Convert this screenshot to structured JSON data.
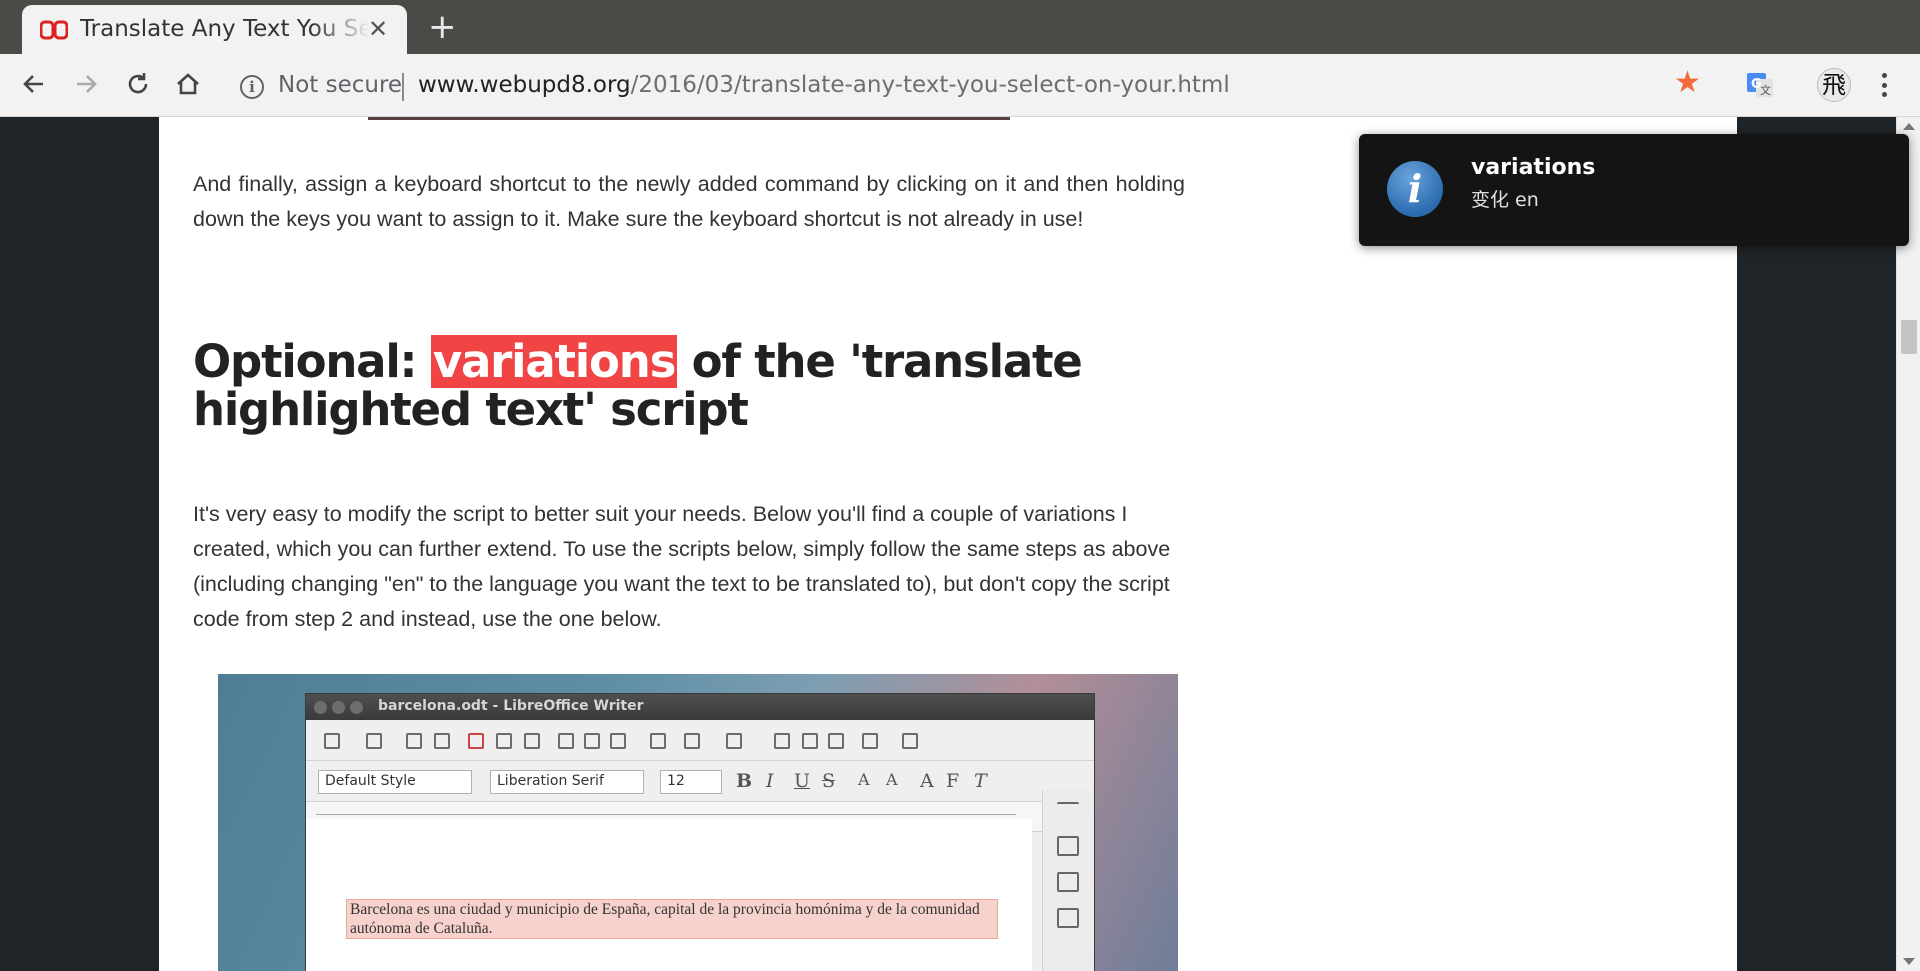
{
  "browser": {
    "tab_title": "Translate Any Text You Select on Your Desktop",
    "url_security": "Not secure",
    "url_host": "www.webupd8.org",
    "url_path": "/2016/03/translate-any-text-you-select-on-your.html",
    "avatar_glyph": "飛"
  },
  "article": {
    "para1": "And finally, assign a keyboard shortcut to the newly added command by clicking on it and then holding down the keys you want to assign to it. Make sure the keyboard shortcut is not already in use!",
    "heading_prefix": "Optional: ",
    "heading_highlight": "variations",
    "heading_suffix": " of the 'translate highlighted text' script",
    "para2": "It's very easy to modify the script to better suit your needs. Below you'll find a couple of variations I created, which you can further extend. To use the scripts below, simply follow the same steps as above (including changing \"en\" to the language you want the text to be translated to), but don't copy the script code from step 2 and instead, use the one below."
  },
  "screenshot": {
    "window_title": "barcelona.odt - LibreOffice Writer",
    "paragraph_style": "Default Style",
    "font_name": "Liberation Serif",
    "font_size": "12",
    "doc_text": "Barcelona es una ciudad y municipio de España, capital de la provincia homónima y de la comunidad autónoma de Cataluña."
  },
  "notification": {
    "title": "variations",
    "body": "变化 en",
    "icon": "info-icon"
  },
  "colors": {
    "highlight": "#f14545",
    "star": "#f26b3a"
  }
}
